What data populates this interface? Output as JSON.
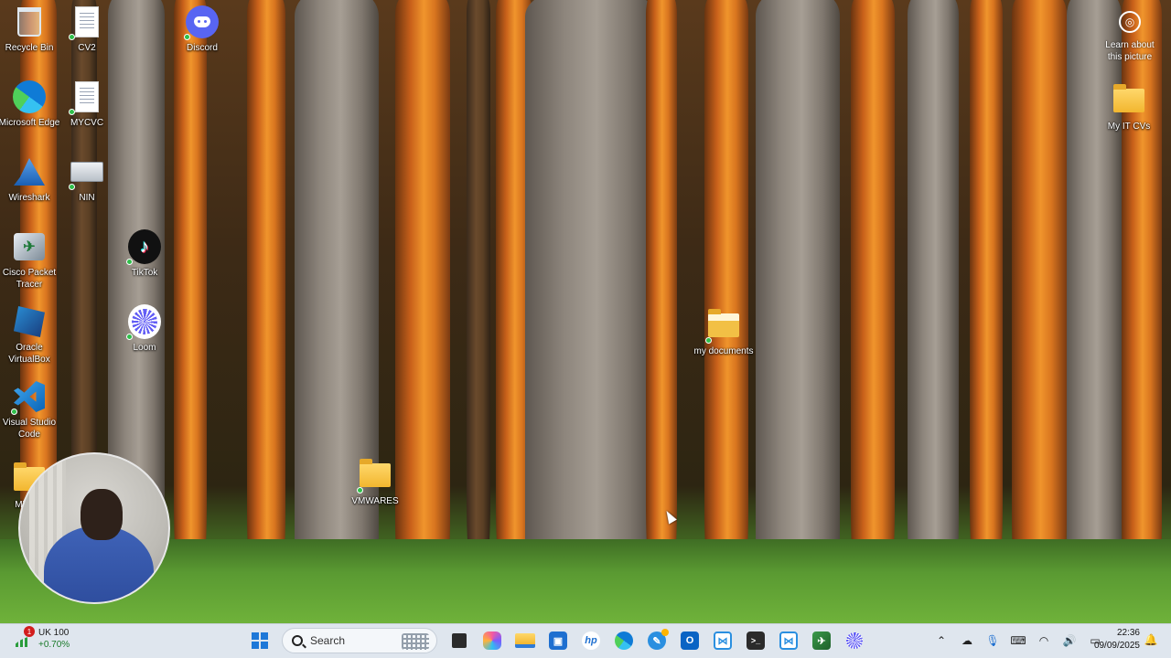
{
  "desktop": {
    "learn_label": "Learn about this picture",
    "icons": [
      {
        "label": "Recycle Bin",
        "icon": "recycle-bin-icon"
      },
      {
        "label": "CV2",
        "icon": "document-icon"
      },
      {
        "label": "Discord",
        "icon": "discord-icon"
      },
      {
        "label": "Microsoft Edge",
        "icon": "edge-icon"
      },
      {
        "label": "MYCVC",
        "icon": "document-icon"
      },
      {
        "label": "Wireshark",
        "icon": "wireshark-icon"
      },
      {
        "label": "NIN",
        "icon": "document-icon"
      },
      {
        "label": "Cisco Packet Tracer",
        "icon": "cisco-packet-tracer-icon"
      },
      {
        "label": "TikTok",
        "icon": "tiktok-icon"
      },
      {
        "label": "Oracle VirtualBox",
        "icon": "virtualbox-icon"
      },
      {
        "label": "Loom",
        "icon": "loom-icon"
      },
      {
        "label": "Visual Studio Code",
        "icon": "vscode-icon"
      },
      {
        "label": "MY PR",
        "icon": "folder-icon"
      },
      {
        "label": "VMWARES",
        "icon": "folder-icon"
      },
      {
        "label": "my documents",
        "icon": "folder-icon"
      },
      {
        "label": "My IT CVs",
        "icon": "folder-icon"
      }
    ]
  },
  "taskbar": {
    "widget": {
      "title": "UK 100",
      "change": "+0.70%",
      "badge": "1"
    },
    "search_placeholder": "Search",
    "apps": [
      "file-explorer-icon",
      "copilot-icon",
      "folder-icon",
      "store-icon",
      "hp-icon",
      "edge-icon",
      "pen-icon",
      "outlook-icon",
      "vs-icon",
      "terminal-icon",
      "vs-icon",
      "packet-tracer-icon",
      "loom-icon"
    ],
    "clock": {
      "time": "22:36",
      "date": "09/09/2025"
    }
  },
  "colors": {
    "taskbar_bg": "#dfe6ee",
    "accent": "#1e78d8"
  }
}
